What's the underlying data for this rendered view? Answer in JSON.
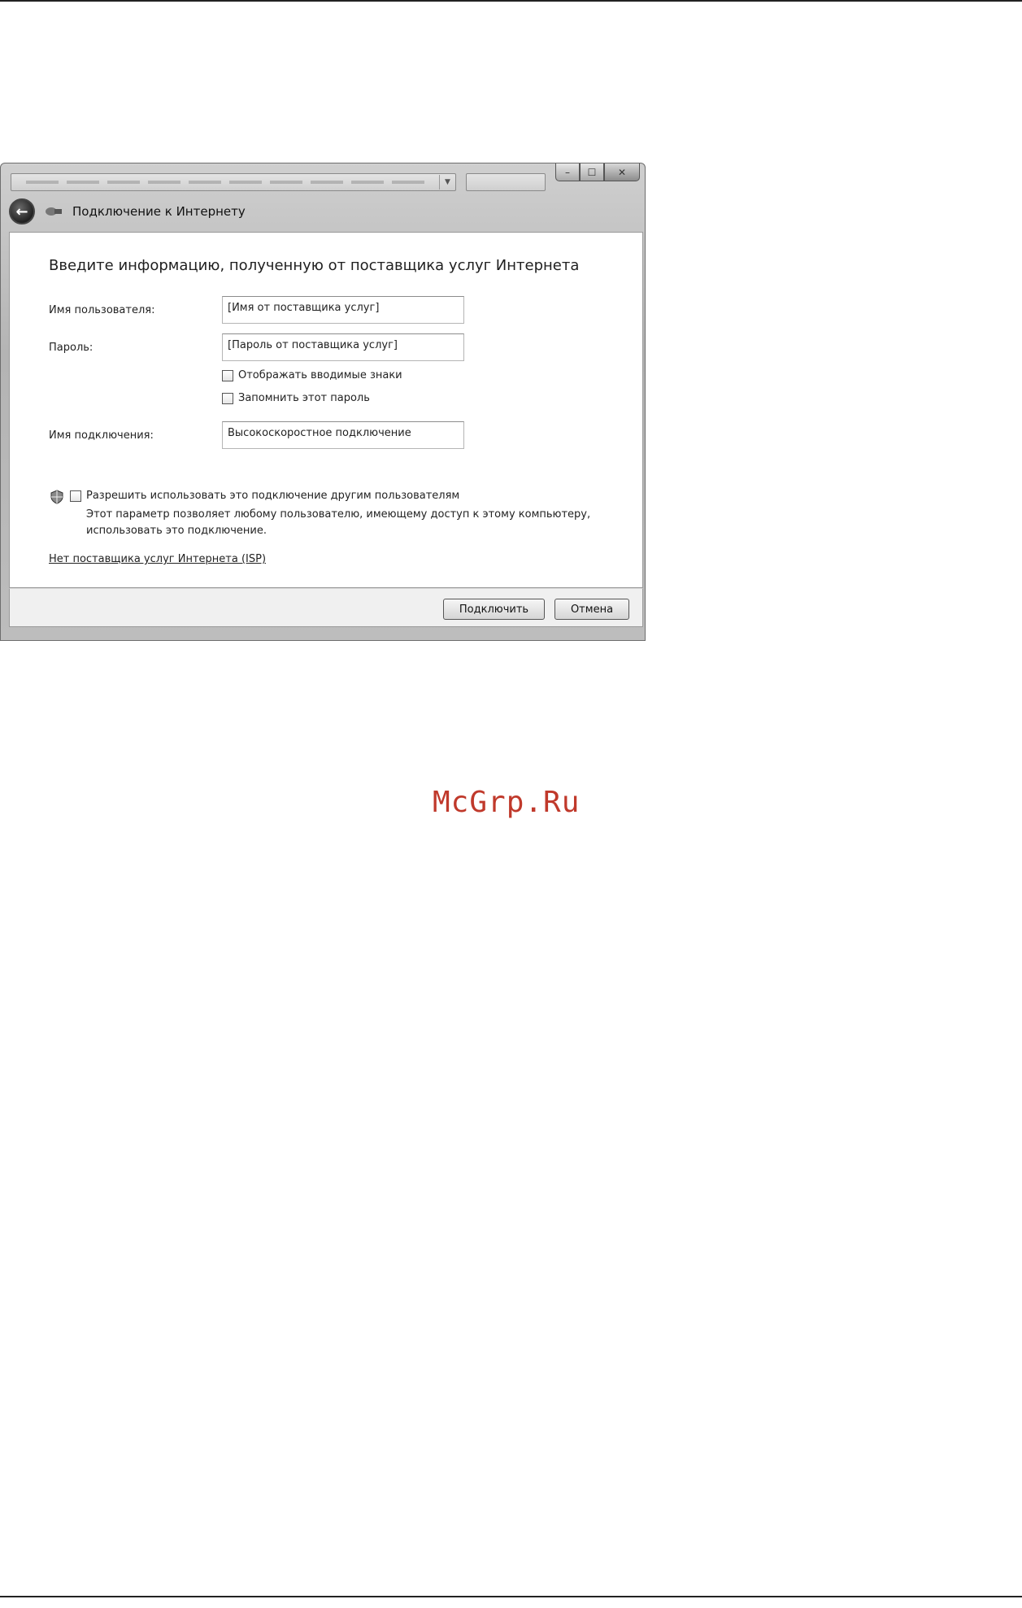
{
  "window": {
    "title": "Подключение к Интернету"
  },
  "form": {
    "heading": "Введите информацию, полученную от поставщика услуг Интернета",
    "username_label": "Имя пользователя:",
    "username_value": "[Имя от поставщика услуг]",
    "password_label": "Пароль:",
    "password_value": "[Пароль от поставщика услуг]",
    "show_chars_label": "Отображать вводимые знаки",
    "remember_label": "Запомнить этот пароль",
    "connection_name_label": "Имя подключения:",
    "connection_name_value": "Высокоскоростное подключение",
    "allow_others_label": "Разрешить использовать это подключение другим пользователям",
    "allow_others_desc": "Этот параметр позволяет любому пользователю, имеющему доступ к этому компьютеру, использовать это подключение.",
    "no_isp_link": "Нет поставщика услуг Интернета (ISP)"
  },
  "footer": {
    "connect_label": "Подключить",
    "cancel_label": "Отмена"
  },
  "watermark": "McGrp.Ru",
  "colors": {
    "watermark": "#c0392b"
  }
}
